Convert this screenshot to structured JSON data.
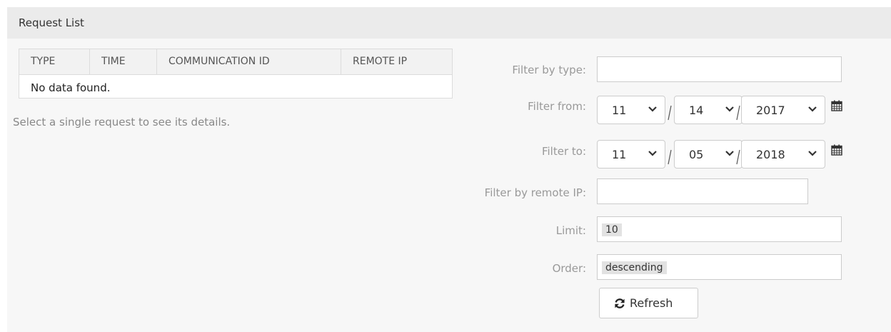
{
  "panel": {
    "title": "Request List"
  },
  "table": {
    "columns": [
      "TYPE",
      "TIME",
      "COMMUNICATION ID",
      "REMOTE IP"
    ],
    "empty_message": "No data found."
  },
  "hint": "Select a single request to see its details.",
  "filters": {
    "type": {
      "label": "Filter by type:",
      "value": ""
    },
    "from": {
      "label": "Filter from:",
      "month": "11",
      "day": "14",
      "year": "2017"
    },
    "to": {
      "label": "Filter to:",
      "month": "11",
      "day": "05",
      "year": "2018"
    },
    "remote_ip": {
      "label": "Filter by remote IP:",
      "value": ""
    },
    "limit": {
      "label": "Limit:",
      "value": "10"
    },
    "order": {
      "label": "Order:",
      "value": "descending"
    }
  },
  "refresh_button": {
    "label": "Refresh"
  },
  "icons": {
    "calendar": "calendar-icon",
    "chevron": "chevron-down-icon",
    "refresh": "refresh-icon"
  },
  "colors": {
    "header_bg": "#ebebeb",
    "panel_bg": "#f7f7f7",
    "label": "#999999"
  }
}
